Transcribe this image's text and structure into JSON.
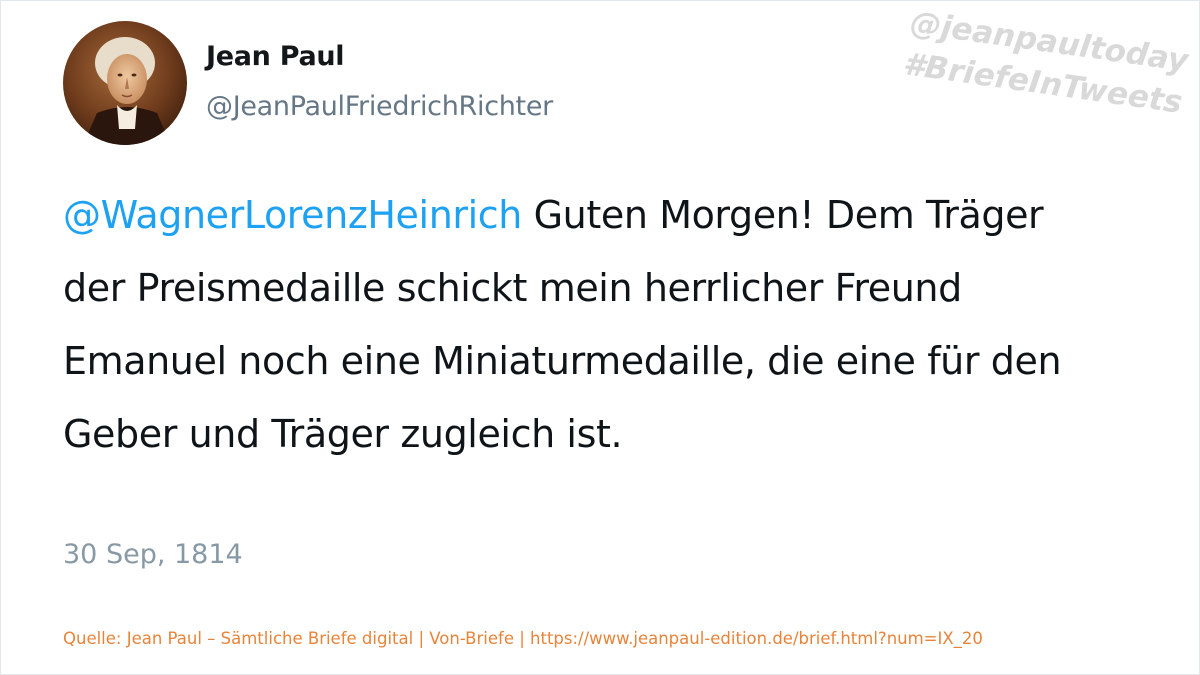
{
  "tweet": {
    "author_name": "Jean Paul",
    "author_handle": "@JeanPaulFriedrichRichter",
    "mention": "@WagnerLorenzHeinrich",
    "text": " Guten Morgen! Dem Träger der Preismedaille schickt mein herrlicher Freund Emanuel noch eine Miniaturmedaille, die eine für den Geber und Träger zugleich ist.",
    "date": "30 Sep, 1814"
  },
  "watermark": {
    "line1": "@jeanpaultoday",
    "line2": "#BriefeInTweets"
  },
  "source": "Quelle: Jean Paul – Sämtliche Briefe digital | Von-Briefe | https://www.jeanpaul-edition.de/brief.html?num=IX_20",
  "colors": {
    "mention": "#1da1f2",
    "text": "#0f1419",
    "secondary": "#657786",
    "source": "#e8843a",
    "watermark": "#d9d9d9"
  }
}
